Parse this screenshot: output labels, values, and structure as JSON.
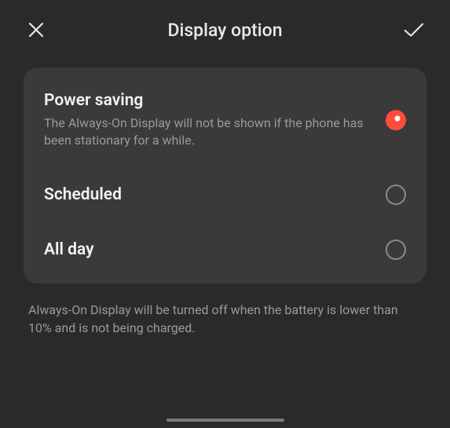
{
  "header": {
    "title": "Display option"
  },
  "options": [
    {
      "title": "Power saving",
      "description": "The Always-On Display will not be shown if the phone has been stationary for a while.",
      "selected": true
    },
    {
      "title": "Scheduled",
      "description": "",
      "selected": false
    },
    {
      "title": "All day",
      "description": "",
      "selected": false
    }
  ],
  "footer_note": "Always-On Display will be turned off when the battery is lower than 10% and is not being charged.",
  "colors": {
    "accent": "#ff4d3d",
    "background": "#2a2a2a",
    "card": "#3a3a3a"
  }
}
